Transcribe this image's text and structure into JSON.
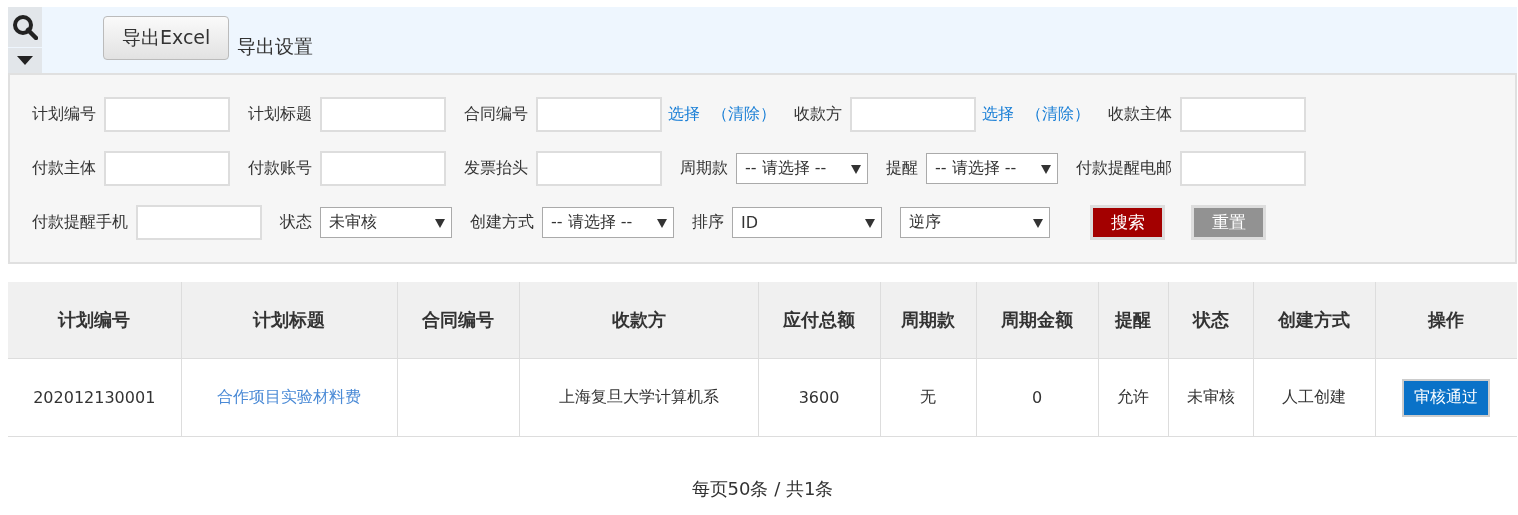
{
  "toolbar": {
    "export_button": "导出Excel",
    "settings_link": "导出设置"
  },
  "filters": [
    [
      {
        "kind": "input",
        "label": "计划编号"
      },
      {
        "kind": "input",
        "label": "计划标题"
      },
      {
        "kind": "input",
        "label": "合同编号",
        "links": [
          "选择",
          "（清除）"
        ]
      },
      {
        "kind": "input",
        "label": "收款方",
        "links": [
          "选择",
          "（清除）"
        ]
      },
      {
        "kind": "input",
        "label": "收款主体"
      }
    ],
    [
      {
        "kind": "input",
        "label": "付款主体"
      },
      {
        "kind": "input",
        "label": "付款账号"
      },
      {
        "kind": "input",
        "label": "发票抬头"
      },
      {
        "kind": "select",
        "label": "周期款",
        "value": "-- 请选择 --"
      },
      {
        "kind": "select",
        "label": "提醒",
        "value": "-- 请选择 --"
      },
      {
        "kind": "input",
        "label": "付款提醒电邮"
      }
    ],
    [
      {
        "kind": "input",
        "label": "付款提醒手机"
      },
      {
        "kind": "select",
        "label": "状态",
        "value": "未审核"
      },
      {
        "kind": "select",
        "label": "创建方式",
        "value": "-- 请选择 --"
      },
      {
        "kind": "select",
        "label": "排序",
        "value": "ID"
      },
      {
        "kind": "select",
        "value": "逆序"
      },
      {
        "kind": "search_button",
        "text": "搜索"
      },
      {
        "kind": "reset_button",
        "text": "重置"
      }
    ]
  ],
  "table": {
    "columns": [
      "计划编号",
      "计划标题",
      "合同编号",
      "收款方",
      "应付总额",
      "周期款",
      "周期金额",
      "提醒",
      "状态",
      "创建方式",
      "操作"
    ],
    "rows": [
      {
        "cells": [
          {
            "kind": "text",
            "text": "202012130001"
          },
          {
            "kind": "link",
            "text": "合作项目实验材料费"
          },
          {
            "kind": "empty"
          },
          {
            "kind": "text",
            "text": "上海复旦大学计算机系"
          },
          {
            "kind": "text",
            "text": "3600"
          },
          {
            "kind": "text",
            "text": "无"
          },
          {
            "kind": "text",
            "text": "0"
          },
          {
            "kind": "text",
            "text": "允许"
          },
          {
            "kind": "text",
            "text": "未审核"
          },
          {
            "kind": "text",
            "text": "人工创建"
          },
          {
            "kind": "button",
            "text": "审核通过"
          }
        ]
      }
    ]
  },
  "pager": "每页50条 / 共1条"
}
